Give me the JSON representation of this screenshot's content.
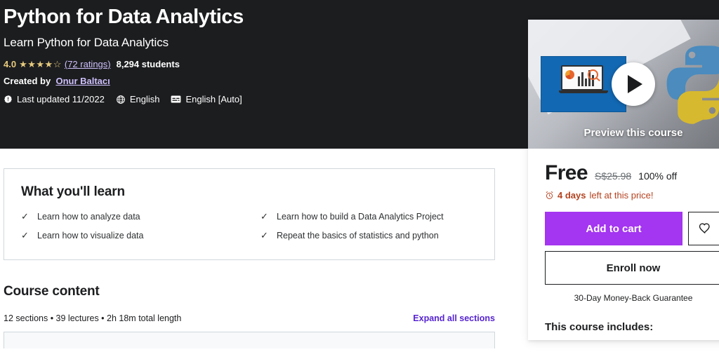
{
  "hero": {
    "title": "Python for Data Analytics",
    "subtitle": "Learn Python for Data Analytics",
    "rating_value": "4.0",
    "stars_glyph": "★★★★☆",
    "ratings_link": "(72 ratings)",
    "students": "8,294 students",
    "created_by_label": "Created by",
    "instructor": "Onur Baltacı",
    "last_updated": "Last updated 11/2022",
    "language": "English",
    "captions": "English [Auto]"
  },
  "learn": {
    "heading": "What you'll learn",
    "items": [
      "Learn how to analyze data",
      "Learn how to build a Data Analytics Project",
      "Learn how to visualize data",
      "Repeat the basics of statistics and python"
    ],
    "check_glyph": "✓"
  },
  "course_content": {
    "heading": "Course content",
    "summary": "12 sections • 39 lectures • 2h 18m total length",
    "expand_label": "Expand all sections"
  },
  "buy_card": {
    "preview_label": "Preview this course",
    "price_current": "Free",
    "price_original": "S$25.98",
    "price_discount": "100% off",
    "deal_days": "4 days",
    "deal_rest": "left at this price!",
    "add_to_cart": "Add to cart",
    "enroll_now": "Enroll now",
    "guarantee": "30-Day Money-Back Guarantee",
    "includes_title": "This course includes:"
  },
  "colors": {
    "hero_bg": "#1c1d1f",
    "accent_purple": "#a435f0",
    "link_purple": "#5624d0",
    "hero_link": "#cec0fc",
    "star_gold": "#e7cb7e",
    "deal_red": "#b4421f",
    "border_gray": "#d1d7dc"
  }
}
